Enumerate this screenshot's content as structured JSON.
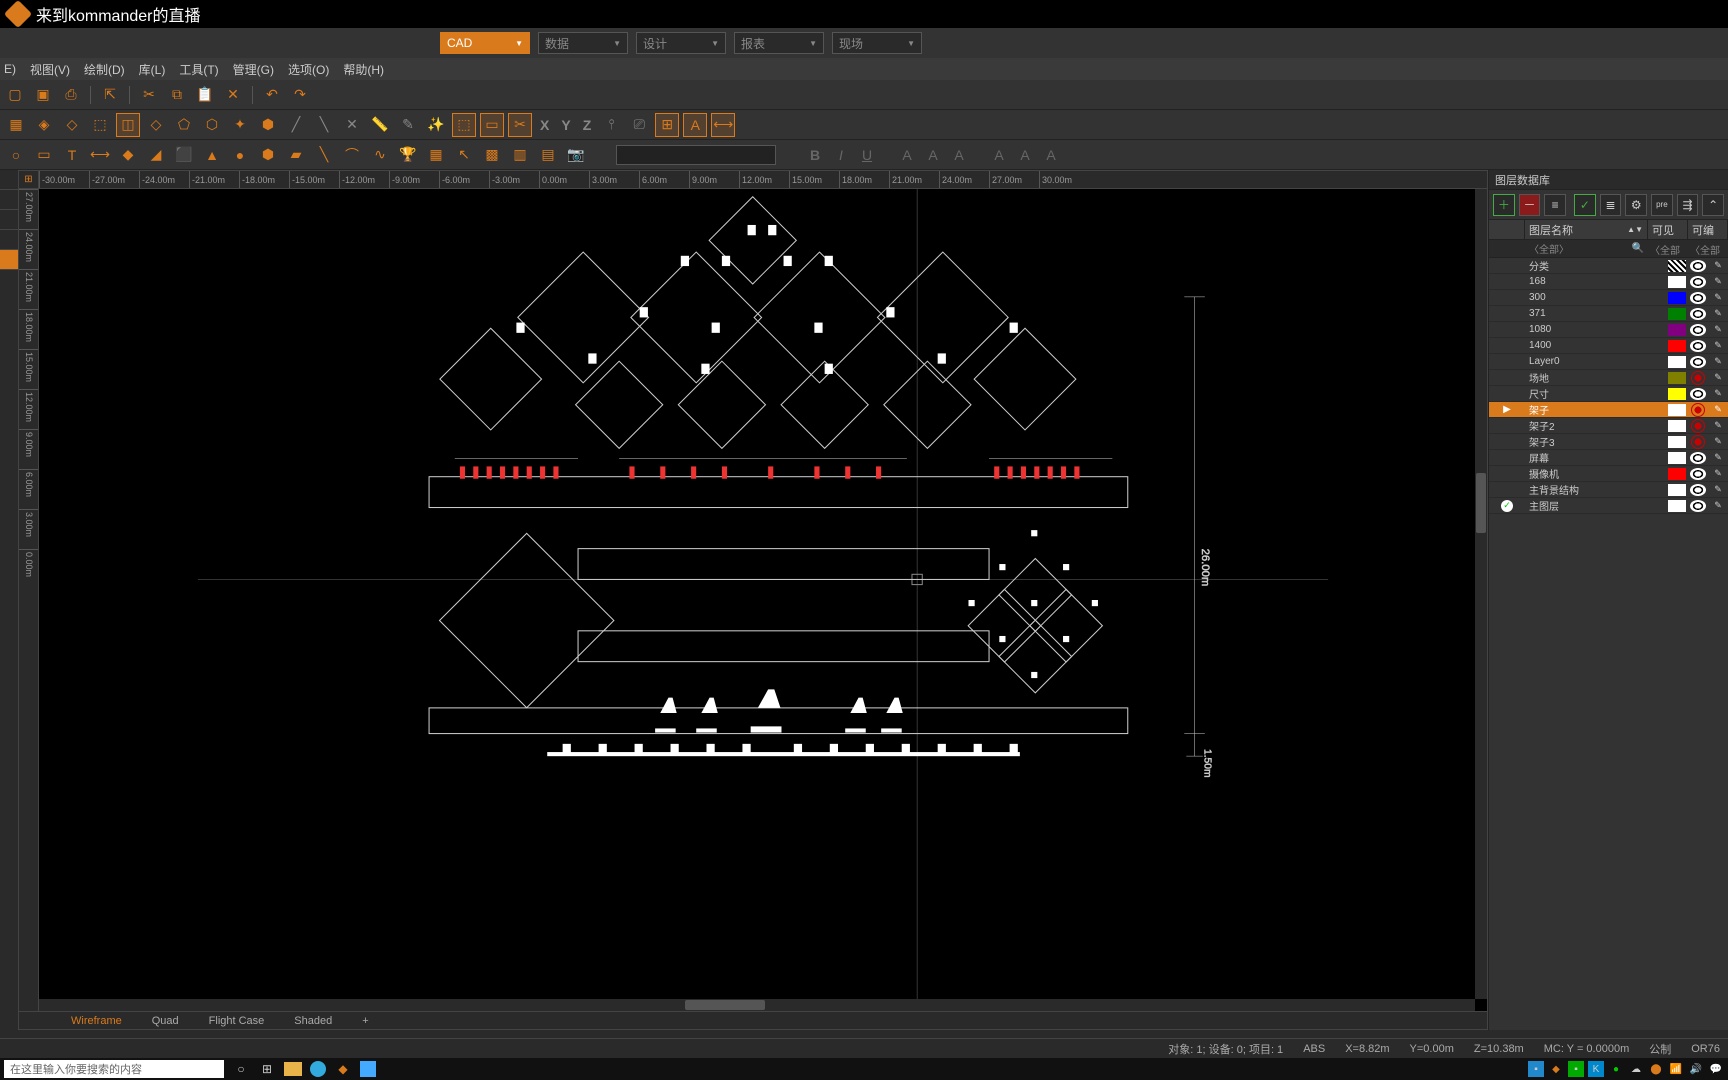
{
  "title": "来到kommander的直播",
  "modeTabs": [
    {
      "label": "CAD",
      "active": true
    },
    {
      "label": "数据",
      "active": false
    },
    {
      "label": "设计",
      "active": false
    },
    {
      "label": "报表",
      "active": false
    },
    {
      "label": "现场",
      "active": false
    }
  ],
  "menus": [
    "E)",
    "视图(V)",
    "绘制(D)",
    "库(L)",
    "工具(T)",
    "管理(G)",
    "选项(O)",
    "帮助(H)"
  ],
  "rulerH": [
    "-30.00m",
    "-27.00m",
    "-24.00m",
    "-21.00m",
    "-18.00m",
    "-15.00m",
    "-12.00m",
    "-9.00m",
    "-6.00m",
    "-3.00m",
    "0.00m",
    "3.00m",
    "6.00m",
    "9.00m",
    "12.00m",
    "15.00m",
    "18.00m",
    "21.00m",
    "24.00m",
    "27.00m",
    "30.00m"
  ],
  "rulerV": [
    "27.00m",
    "24.00m",
    "21.00m",
    "18.00m",
    "15.00m",
    "12.00m",
    "9.00m",
    "6.00m",
    "3.00m",
    "0.00m"
  ],
  "bottomTabs": [
    {
      "label": "Wireframe",
      "active": true
    },
    {
      "label": "Quad",
      "active": false
    },
    {
      "label": "Flight Case",
      "active": false
    },
    {
      "label": "Shaded",
      "active": false
    },
    {
      "label": "+",
      "active": false
    }
  ],
  "dims": {
    "height": "26.00m",
    "offset": "1.50m"
  },
  "rightPanel": {
    "title": "图层数据库",
    "header": {
      "name": "图层名称",
      "visible": "可见",
      "editable": "可编辑"
    },
    "filter": {
      "all": "〈全部〉",
      "search": "🔍",
      "all2": "〈全部",
      "all3": "〈全部"
    },
    "layers": [
      {
        "name": "分类",
        "color": "hatch",
        "eye": true,
        "selected": false
      },
      {
        "name": "168",
        "color": "#ffffff",
        "eye": true
      },
      {
        "name": "300",
        "color": "#0000ff",
        "eye": true
      },
      {
        "name": "371",
        "color": "#008000",
        "eye": true
      },
      {
        "name": "1080",
        "color": "#800080",
        "eye": true
      },
      {
        "name": "1400",
        "color": "#ff0000",
        "eye": true
      },
      {
        "name": "Layer0",
        "color": "#ffffff",
        "eye": true
      },
      {
        "name": "场地",
        "color": "#808000",
        "eye": false
      },
      {
        "name": "尺寸",
        "color": "#ffff00",
        "eye": true
      },
      {
        "name": "架子",
        "color": "#ffffff",
        "eye": false,
        "selected": true,
        "arrow": true
      },
      {
        "name": "架子2",
        "color": "#ffffff",
        "eye": false
      },
      {
        "name": "架子3",
        "color": "#ffffff",
        "eye": false
      },
      {
        "name": "屏幕",
        "color": "#ffffff",
        "eye": true
      },
      {
        "name": "摄像机",
        "color": "#ff0000",
        "eye": true
      },
      {
        "name": "主背景结构",
        "color": "#ffffff",
        "eye": true
      },
      {
        "name": "主图层",
        "color": "#ffffff",
        "eye": true,
        "check": true
      }
    ]
  },
  "status": {
    "objects": "对象: 1; 设备: 0; 项目: 1",
    "abs": "ABS",
    "x": "X=8.82m",
    "y": "Y=0.00m",
    "z": "Z=10.38m",
    "mc": "MC: Y = 0.0000m",
    "unit": "公制",
    "extra": "OR76"
  },
  "taskbar": {
    "search": "在这里输入你要搜索的内容"
  },
  "fmt": {
    "b": "B",
    "i": "I",
    "u": "U",
    "a": "A"
  },
  "toolbar2": {
    "x": "X",
    "y": "Y",
    "z": "Z"
  }
}
